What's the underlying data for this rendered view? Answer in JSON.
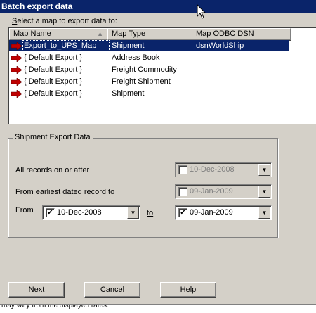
{
  "window": {
    "title": "Batch export data"
  },
  "list": {
    "hint": "Select a map to export data to:",
    "columns": [
      "Map Name",
      "Map Type",
      "Map ODBC DSN"
    ],
    "rows": [
      {
        "name": "Export_to_UPS_Map",
        "type": "Shipment",
        "dsn": "dsnWorldShip",
        "selected": true
      },
      {
        "name": "{ Default Export }",
        "type": "Address Book",
        "dsn": ""
      },
      {
        "name": "{ Default Export }",
        "type": "Freight Commodity",
        "dsn": ""
      },
      {
        "name": "{ Default Export }",
        "type": "Freight Shipment",
        "dsn": ""
      },
      {
        "name": "{ Default Export }",
        "type": "Shipment",
        "dsn": ""
      }
    ]
  },
  "group": {
    "title": "Shipment Export Data",
    "all_records_label": "All records on or after",
    "all_records_date": "10-Dec-2008",
    "earliest_label": "From earliest dated record to",
    "earliest_date": "09-Jan-2009",
    "from_label": "From",
    "from_date": "10-Dec-2008",
    "to_label": "to",
    "to_date": "09-Jan-2009"
  },
  "buttons": {
    "next": "Next",
    "cancel": "Cancel",
    "help": "Help"
  },
  "footer_text": "may vary from the displayed rates.",
  "colors": {
    "title_bar": "#0a246a",
    "selection": "#0a246a",
    "face": "#d4d0c8",
    "row_icon": "#c00000"
  },
  "icons": {
    "row_icon": "red-arrow-icon",
    "checkbox_mark": "✔",
    "dropdown": "▼",
    "sort": "▲"
  }
}
